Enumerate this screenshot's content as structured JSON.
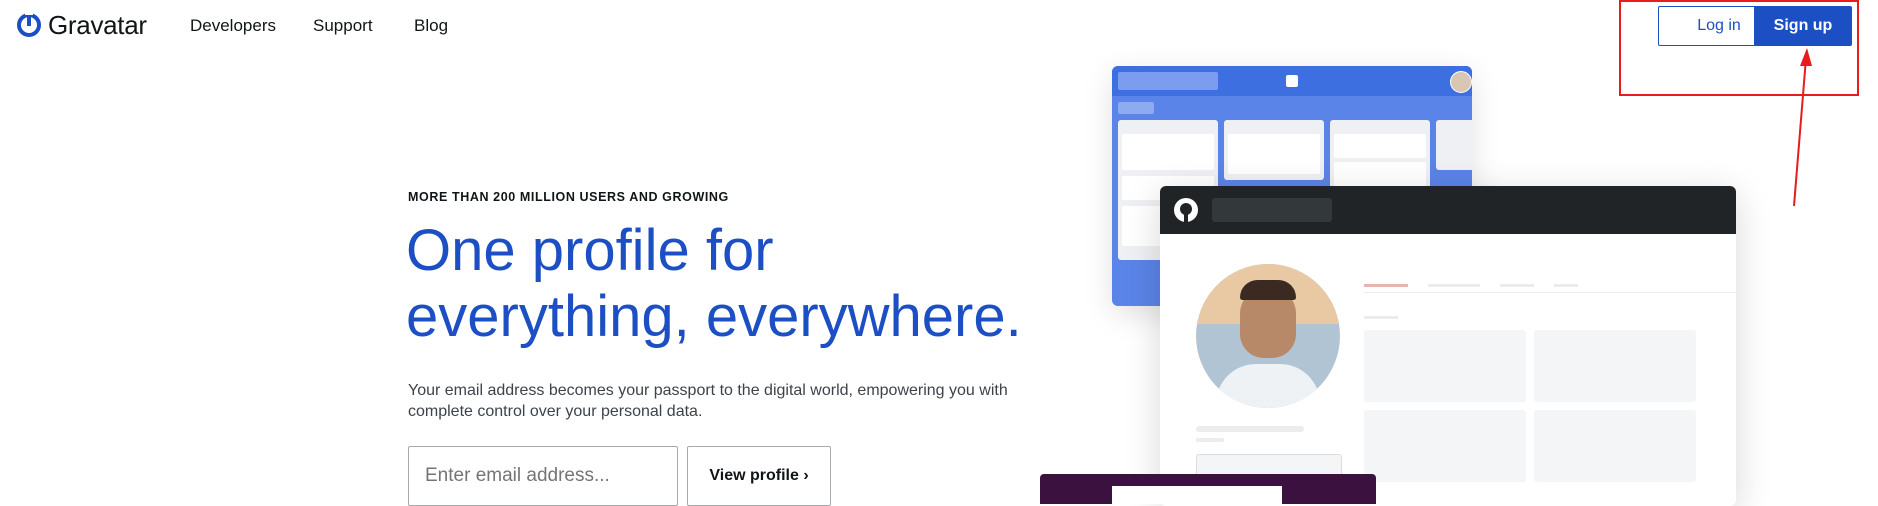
{
  "header": {
    "brand": "Gravatar",
    "nav": [
      "Developers",
      "Support",
      "Blog"
    ],
    "login_label": "Log in",
    "signup_label": "Sign up"
  },
  "hero": {
    "eyebrow": "MORE THAN 200 MILLION USERS AND GROWING",
    "headline_line1": "One profile for",
    "headline_line2": "everything, everywhere.",
    "description": "Your email address becomes your passport to the digital world, empowering you with complete control over your personal data.",
    "email_placeholder": "Enter email address...",
    "view_profile_label": "View profile ›"
  },
  "colors": {
    "brand_blue": "#1d4fc4",
    "annotation_red": "#e81c1c"
  },
  "icons": [
    "gravatar-logo-icon",
    "trello-icon",
    "github-icon"
  ]
}
